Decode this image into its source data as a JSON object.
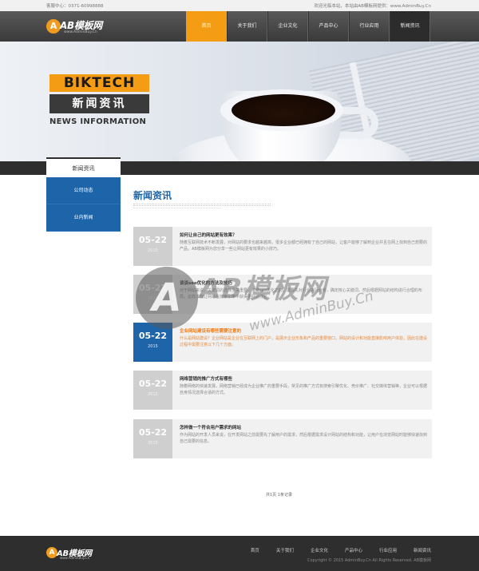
{
  "topbar": {
    "hotline": "客服中心：0371-60998888",
    "welcome": "欢迎光临本站，本站由AB模板网提供：www.AdminBuy.Cn"
  },
  "logo": {
    "mark": "A",
    "text": "AB模板网",
    "sub": "www.AdminBuy.Cn"
  },
  "nav": {
    "items": [
      "首页",
      "关于我们",
      "企业文化",
      "产品中心",
      "行业应用",
      "新闻资讯"
    ]
  },
  "banner": {
    "brand": "BIKTECH",
    "title": "新闻资讯",
    "subtitle": "NEWS INFORMATION"
  },
  "sidebar": {
    "title": "新闻资讯",
    "items": [
      "公司动态",
      "业内新闻"
    ]
  },
  "main": {
    "title": "新闻资讯",
    "news": [
      {
        "date": "05-22",
        "year": "2015",
        "headline": "如何让自己的网站更有效果？",
        "summary": "随着互联网技术不断发展，对网站的要求也越来越高，很多企业都已经拥有了自己的网站，让客户能够了解到企业并且在网上找到自己想要的产品，AB模板网为您分享一些让网站更有效果的小技巧。"
      },
      {
        "date": "05-22",
        "year": "2015",
        "headline": "谈谈seo优化的方法及技巧",
        "summary": "对于网站来说，关键词的选择至关重要，在做seo优化之前，需要先对行业进行分析，确定核心关键词，然后根据网站的结构进行合理的布局，这样才能让网站在搜索引擎中获得更好的排名。"
      },
      {
        "date": "05-22",
        "year": "2015",
        "headline": "企业网站建设有哪些需要注意的",
        "summary": "什么是网站建设？企业网站是企业在互联网上的门户，是展示企业形象和产品的重要窗口，网站的设计和功能直接影响用户体验，因此在建设过程中需要注意以下几个方面。"
      },
      {
        "date": "05-22",
        "year": "2015",
        "headline": "网络营销的推广方式有哪些",
        "summary": "随着网络的快速发展，网络营销已经成为企业推广的重要手段，常见的推广方式有搜索引擎优化、竞价推广、社交媒体营销等，企业可以根据自身情况选择合适的方式。"
      },
      {
        "date": "05-22",
        "year": "2015",
        "headline": "怎样做一个符合用户需求的网站",
        "summary": "作为网站的开发人员来说，在开发网站之前需要先了解用户的需求，然后根据需求设计网站的结构和功能，让用户在浏览网站时能够快速找到自己需要的信息。"
      }
    ]
  },
  "pager": {
    "text": "共1页 1条记录"
  },
  "footer": {
    "nav": [
      "首页",
      "关于我们",
      "企业文化",
      "产品中心",
      "行业应用",
      "新闻资讯"
    ],
    "copyright": "Copyright © 2015 AdminBuy.Cn All Rights Reserved. AB模板网"
  },
  "watermark": {
    "text": "AB模板网",
    "url": "www.AdminBuy.Cn"
  },
  "colors": {
    "accent": "#f49c14",
    "blue": "#1e64a8",
    "highlight_text": "#ee7c17",
    "dark": "#2e2e2e"
  }
}
